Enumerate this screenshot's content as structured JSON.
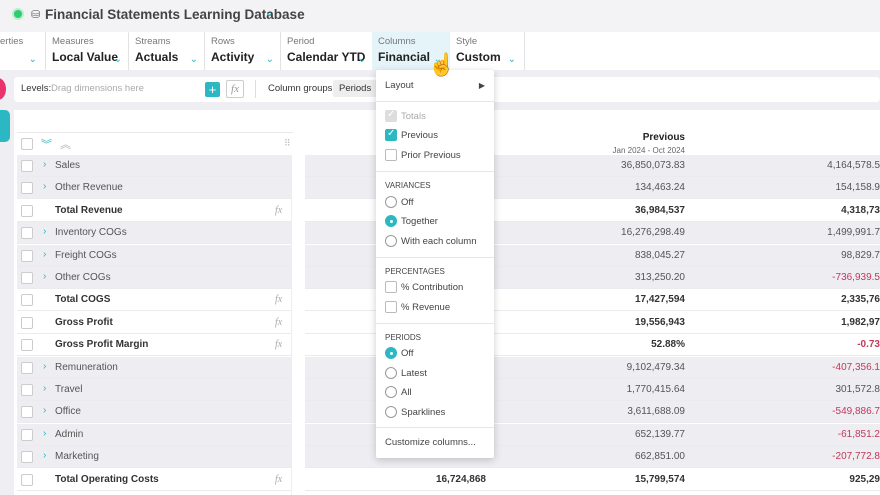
{
  "header": {
    "title": "Financial Statements Learning Database"
  },
  "toolbar": [
    {
      "label": "erties",
      "value": ""
    },
    {
      "label": "Measures",
      "value": "Local Value"
    },
    {
      "label": "Streams",
      "value": "Actuals"
    },
    {
      "label": "Rows",
      "value": "Activity"
    },
    {
      "label": "Period",
      "value": "Calendar YTD"
    },
    {
      "label": "Columns",
      "value": "Financial"
    },
    {
      "label": "Style",
      "value": "Custom"
    }
  ],
  "levels": {
    "label": "Levels:",
    "placeholder": "Drag dimensions here",
    "column_groups_label": "Column groups:",
    "column_groups_value": "Periods"
  },
  "columns": {
    "previous_title": "Previous",
    "previous_range": "Jan 2024 - Oct 2024"
  },
  "rows": [
    {
      "label": "Sales",
      "expandable": true,
      "bold": false,
      "hidden": "",
      "previous": "36,850,073.83",
      "variance": "4,164,578.5",
      "neg": false
    },
    {
      "label": "Other Revenue",
      "expandable": true,
      "bold": false,
      "hidden": "",
      "previous": "134,463.24",
      "variance": "154,158.9",
      "neg": false
    },
    {
      "label": "Total Revenue",
      "expandable": false,
      "bold": true,
      "hidden": "",
      "previous": "36,984,537",
      "variance": "4,318,73",
      "neg": false
    },
    {
      "label": "Inventory COGs",
      "expandable": true,
      "bold": false,
      "hidden": "",
      "previous": "16,276,298.49",
      "variance": "1,499,991.7",
      "neg": false
    },
    {
      "label": "Freight COGs",
      "expandable": true,
      "bold": false,
      "hidden": "",
      "previous": "838,045.27",
      "variance": "98,829.7",
      "neg": false
    },
    {
      "label": "Other COGs",
      "expandable": true,
      "bold": false,
      "hidden": "",
      "previous": "313,250.20",
      "variance": "-736,939.5",
      "neg": true
    },
    {
      "label": "Total COGS",
      "expandable": false,
      "bold": true,
      "hidden": "",
      "previous": "17,427,594",
      "variance": "2,335,76",
      "neg": false
    },
    {
      "label": "Gross Profit",
      "expandable": false,
      "bold": true,
      "hidden": "",
      "previous": "19,556,943",
      "variance": "1,982,97",
      "neg": false
    },
    {
      "label": "Gross Profit Margin",
      "expandable": false,
      "bold": true,
      "hidden": "",
      "previous": "52.88%",
      "variance": "-0.73",
      "neg": true
    },
    {
      "label": "Remuneration",
      "expandable": true,
      "bold": false,
      "hidden": "",
      "previous": "9,102,479.34",
      "variance": "-407,356.1",
      "neg": true
    },
    {
      "label": "Travel",
      "expandable": true,
      "bold": false,
      "hidden": "",
      "previous": "1,770,415.64",
      "variance": "301,572.8",
      "neg": false
    },
    {
      "label": "Office",
      "expandable": true,
      "bold": false,
      "hidden": "",
      "previous": "3,611,688.09",
      "variance": "-549,886.7",
      "neg": true
    },
    {
      "label": "Admin",
      "expandable": true,
      "bold": false,
      "hidden": "",
      "previous": "652,139.77",
      "variance": "-61,851.2",
      "neg": true
    },
    {
      "label": "Marketing",
      "expandable": true,
      "bold": false,
      "hidden": "",
      "previous": "662,851.00",
      "variance": "-207,772.8",
      "neg": true
    },
    {
      "label": "Total Operating Costs",
      "expandable": false,
      "bold": true,
      "hidden": "16,724,868",
      "previous": "15,799,574",
      "variance": "925,29",
      "neg": false
    }
  ],
  "menu": {
    "layout": "Layout",
    "totals": "Totals",
    "previous": "Previous",
    "prior_previous": "Prior Previous",
    "variances_title": "VARIANCES",
    "var_off": "Off",
    "var_together": "Together",
    "var_each": "With each column",
    "percentages_title": "PERCENTAGES",
    "pct_contribution": "% Contribution",
    "pct_revenue": "% Revenue",
    "periods_title": "PERIODS",
    "per_off": "Off",
    "per_latest": "Latest",
    "per_all": "All",
    "per_sparklines": "Sparklines",
    "customize": "Customize columns..."
  },
  "colors": {
    "accent": "#2bb8c2",
    "negative": "#c0395b"
  }
}
